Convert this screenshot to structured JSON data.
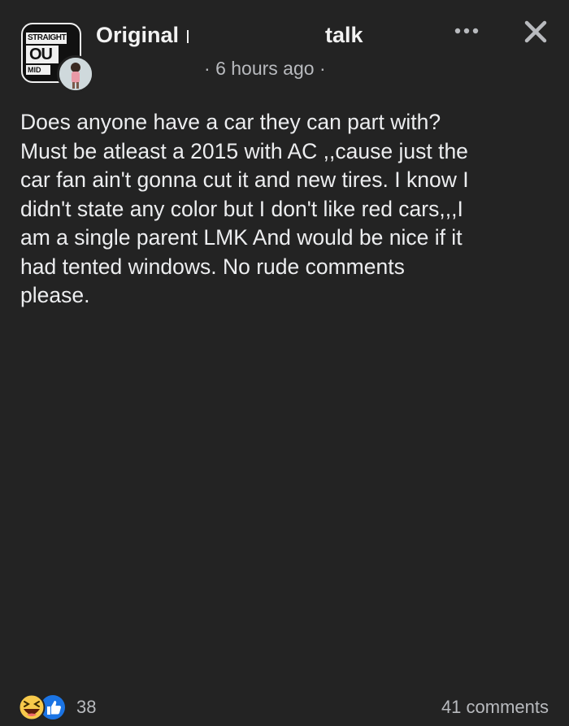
{
  "post": {
    "group_name_start": "Original",
    "group_name_end": "talk",
    "time": "6 hours ago",
    "time_sep": "·",
    "body": "Does anyone have a car they can part with?\nMust be atleast a 2015 with AC ,,cause just the\ncar fan ain't gonna cut it and new tires. I know I\ndidn't state any color but I don't like red cars,,,I\nam a single parent LMK And would be nice if it\nhad tented windows. No rude comments\nplease."
  },
  "group_icon": {
    "line1": "STRAIGHT",
    "line2": "OU",
    "line3": "MID"
  },
  "reactions": {
    "count": "38",
    "icons": [
      "haha-icon",
      "like-icon"
    ]
  },
  "comments": {
    "label": "41 comments"
  },
  "icons": {
    "more": "more-horizontal-icon",
    "close": "close-icon"
  },
  "colors": {
    "background": "#232323",
    "text": "#ecedef",
    "secondary_text": "#b8babe",
    "like_blue": "#1b74e4",
    "haha_yellow": "#f7c94b"
  }
}
